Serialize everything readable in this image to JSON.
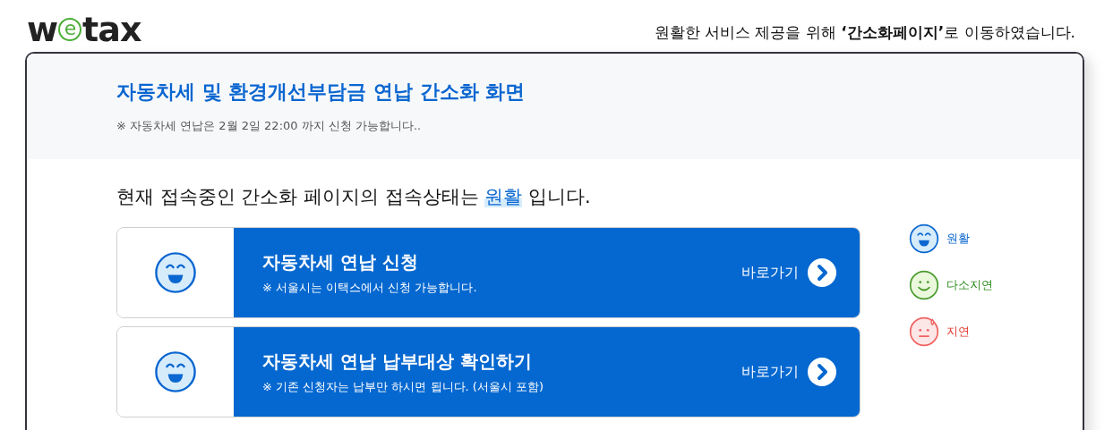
{
  "logo": {
    "before": "w",
    "mark": "e",
    "after": "tax"
  },
  "notice": "원활한 서비스 제공을 위해 **‘간소화페이지’**로 이동하였습니다.",
  "header": {
    "title": "자동차세 및 환경개선부담금 연납 간소화 화면",
    "note": "※ 자동차세 연납은 2월 2일 22:00 까지 신청 가능합니다.."
  },
  "status": {
    "prefix": "현재 접속중인 간소화 페이지의 접속상태는",
    "value": "원활",
    "suffix": "입니다.",
    "kind": "smooth"
  },
  "cards": [
    {
      "kind": "smooth",
      "title": "자동차세 연납 신청",
      "note": "※ 서울시는 이택스에서 신청 가능합니다.",
      "link": "바로가기"
    },
    {
      "kind": "smooth",
      "title": "자동차세 연납 납부대상 확인하기",
      "note": "※ 기존 신청자는 납부만 하시면 됩니다. (서울시 포함)",
      "link": "바로가기"
    }
  ],
  "legend": [
    {
      "kind": "smooth",
      "label": "원활",
      "color": "#0a66d0"
    },
    {
      "kind": "slight",
      "label": "다소지연",
      "color": "#2e8b1e"
    },
    {
      "kind": "delay",
      "label": "지연",
      "color": "#e03a2e"
    }
  ]
}
